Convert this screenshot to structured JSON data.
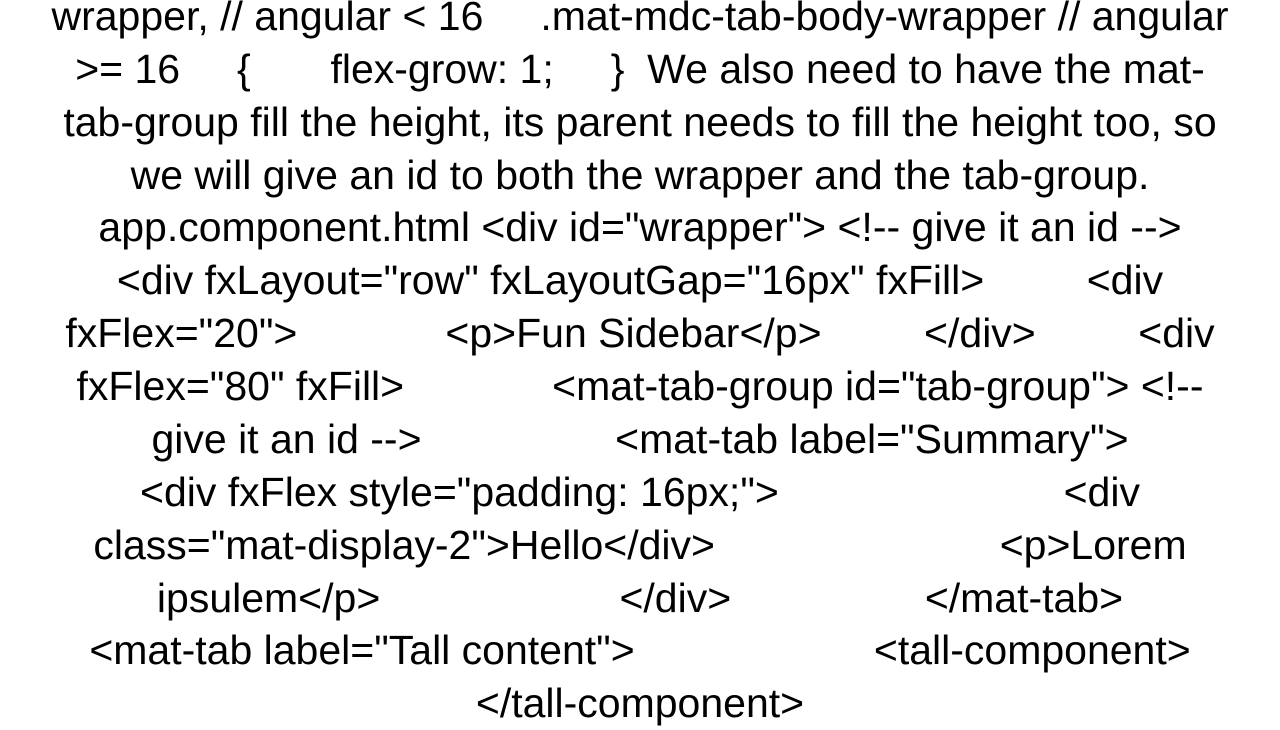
{
  "text": "wrapper, // angular < 16     .mat-mdc-tab-body-wrapper // angular >= 16     {       flex-grow: 1;     }  We also need to have the mat-tab-group fill the height, its parent needs to fill the height too, so we will give an id to both the wrapper and the tab-group. app.component.html <div id=\"wrapper\"> <!-- give it an id -->     <div fxLayout=\"row\" fxLayoutGap=\"16px\" fxFill>         <div fxFlex=\"20\">             <p>Fun Sidebar</p>         </div>         <div fxFlex=\"80\" fxFill>             <mat-tab-group id=\"tab-group\"> <!-- give it an id -->                 <mat-tab label=\"Summary\">                     <div fxFlex style=\"padding: 16px;\">                         <div class=\"mat-display-2\">Hello</div>                         <p>Lorem ipsulem</p>                     </div>                 </mat-tab>                 <mat-tab label=\"Tall content\">                     <tall-component></tall-component>"
}
